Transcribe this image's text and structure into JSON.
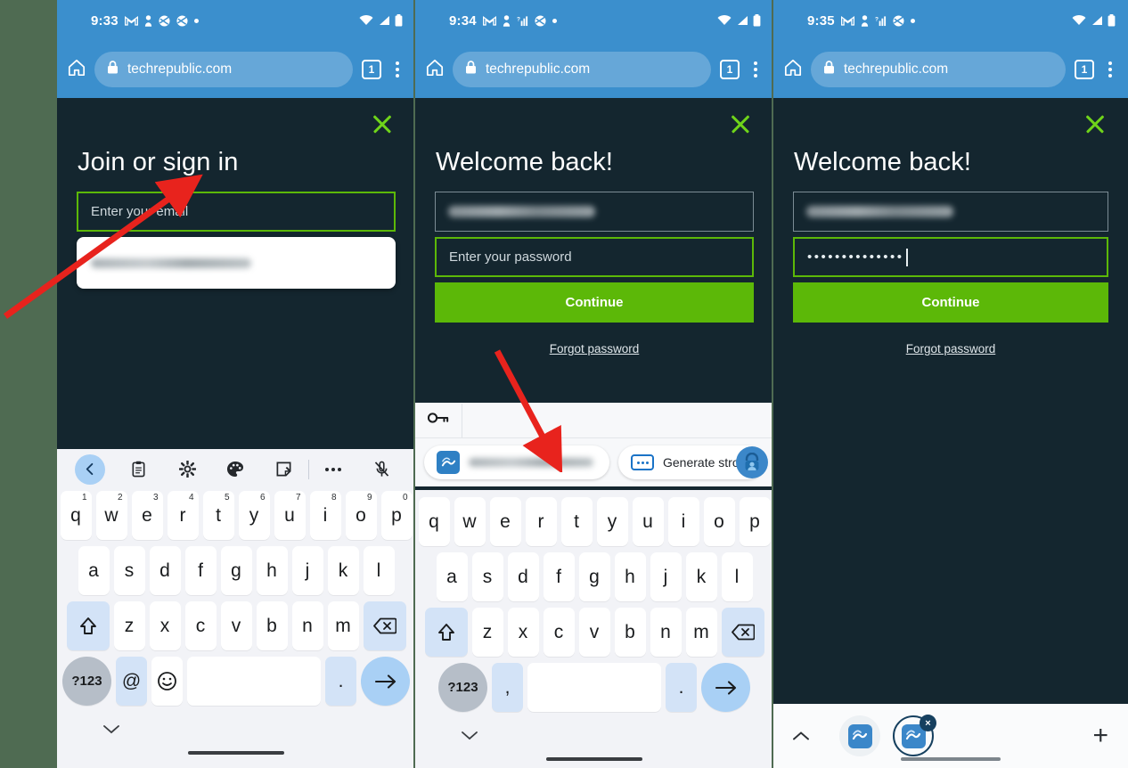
{
  "panels": [
    {
      "id": "panel-1",
      "status": {
        "time": "9:33",
        "icons": [
          "gmail-icon",
          "person-icon",
          "data-saver-icon",
          "incognito-icon",
          "dot-icon"
        ],
        "right_icons": [
          "wifi-icon",
          "signal-icon",
          "battery-icon"
        ]
      },
      "browser": {
        "url": "techrepublic.com",
        "tab_count": "1",
        "home_icon": "home-icon",
        "lock_icon": "lock-icon",
        "menu_icon": "kebab-menu-icon"
      },
      "modal": {
        "title": "Join or sign in",
        "close_icon": "close-icon"
      },
      "email_field": {
        "value": "Enter your email",
        "state": "focused"
      },
      "autofill_suggestion": {
        "value": "",
        "blurred": true
      },
      "keyboard": {
        "toolbar": [
          "back-icon",
          "clipboard-icon",
          "gear-icon",
          "palette-icon",
          "sticker-icon",
          "more-icon",
          "mic-off-icon"
        ],
        "row1": [
          {
            "k": "q",
            "n": "1"
          },
          {
            "k": "w",
            "n": "2"
          },
          {
            "k": "e",
            "n": "3"
          },
          {
            "k": "r",
            "n": "4"
          },
          {
            "k": "t",
            "n": "5"
          },
          {
            "k": "y",
            "n": "6"
          },
          {
            "k": "u",
            "n": "7"
          },
          {
            "k": "i",
            "n": "8"
          },
          {
            "k": "o",
            "n": "9"
          },
          {
            "k": "p",
            "n": "0"
          }
        ],
        "row2": [
          "a",
          "s",
          "d",
          "f",
          "g",
          "h",
          "j",
          "k",
          "l"
        ],
        "row3": [
          "z",
          "x",
          "c",
          "v",
          "b",
          "n",
          "m"
        ],
        "shift_label": "shift-icon",
        "backspace_label": "backspace-icon",
        "sym_key": "?123",
        "extra_key": "@",
        "emoji_key": "emoji-icon",
        "period_key": ".",
        "enter_key": "arrow-right-icon"
      }
    },
    {
      "id": "panel-2",
      "status": {
        "time": "9:34",
        "icons": [
          "gmail-icon",
          "person-icon",
          "signal-alt-icon",
          "incognito-icon",
          "dot-icon"
        ],
        "right_icons": [
          "wifi-icon",
          "signal-icon",
          "battery-icon"
        ]
      },
      "browser": {
        "url": "techrepublic.com",
        "tab_count": "1",
        "home_icon": "home-icon",
        "lock_icon": "lock-icon",
        "menu_icon": "kebab-menu-icon"
      },
      "modal": {
        "title": "Welcome back!",
        "close_icon": "close-icon"
      },
      "email_field": {
        "value": "",
        "state": "idle",
        "blurred": true
      },
      "password_field": {
        "value": "Enter your password",
        "state": "focused"
      },
      "cta": "Continue",
      "forgot": "Forgot password",
      "autofill_bar": {
        "key_icon": "key-icon",
        "credential_chip": {
          "value": "",
          "blurred": true,
          "app_icon": "password-app-icon"
        },
        "generate_chip": {
          "label": "Generate strong p",
          "icon": "password-dots-icon"
        },
        "avatar_icon": "account-lock-icon"
      },
      "keyboard": {
        "row1": [
          "q",
          "w",
          "e",
          "r",
          "t",
          "y",
          "u",
          "i",
          "o",
          "p"
        ],
        "row2": [
          "a",
          "s",
          "d",
          "f",
          "g",
          "h",
          "j",
          "k",
          "l"
        ],
        "row3": [
          "z",
          "x",
          "c",
          "v",
          "b",
          "n",
          "m"
        ],
        "shift_label": "shift-icon",
        "backspace_label": "backspace-icon",
        "sym_key": "?123",
        "extra_key": ",",
        "period_key": ".",
        "enter_key": "arrow-right-icon"
      }
    },
    {
      "id": "panel-3",
      "status": {
        "time": "9:35",
        "icons": [
          "gmail-icon",
          "person-icon",
          "signal-alt-icon",
          "incognito-icon",
          "dot-icon"
        ],
        "right_icons": [
          "wifi-icon",
          "signal-icon",
          "battery-icon"
        ]
      },
      "browser": {
        "url": "techrepublic.com",
        "tab_count": "1",
        "home_icon": "home-icon",
        "lock_icon": "lock-icon",
        "menu_icon": "kebab-menu-icon"
      },
      "modal": {
        "title": "Welcome back!",
        "close_icon": "close-icon"
      },
      "email_field": {
        "value": "",
        "state": "idle",
        "blurred": true
      },
      "password_field": {
        "value": "••••••••••••••",
        "state": "focused"
      },
      "cta": "Continue",
      "forgot": "Forgot password",
      "manager_bar": {
        "chevron_icon": "chevron-up-icon",
        "app_icon_1": "password-app-icon",
        "app_icon_2": "password-app-icon",
        "close_badge": "×",
        "plus_icon": "+"
      }
    }
  ],
  "colors": {
    "browser_blue": "#3b8fcd",
    "page_dark": "#14262f",
    "accent_green": "#5cb808",
    "close_green": "#6fd41a",
    "outer_background": "#4f6b52",
    "annotation_red": "#e8231d",
    "keyboard_bg": "#f2f3f7"
  },
  "annotations": [
    {
      "name": "arrow-to-email-field",
      "color": "#e8231d"
    },
    {
      "name": "arrow-to-credential-chip",
      "color": "#e8231d"
    }
  ]
}
